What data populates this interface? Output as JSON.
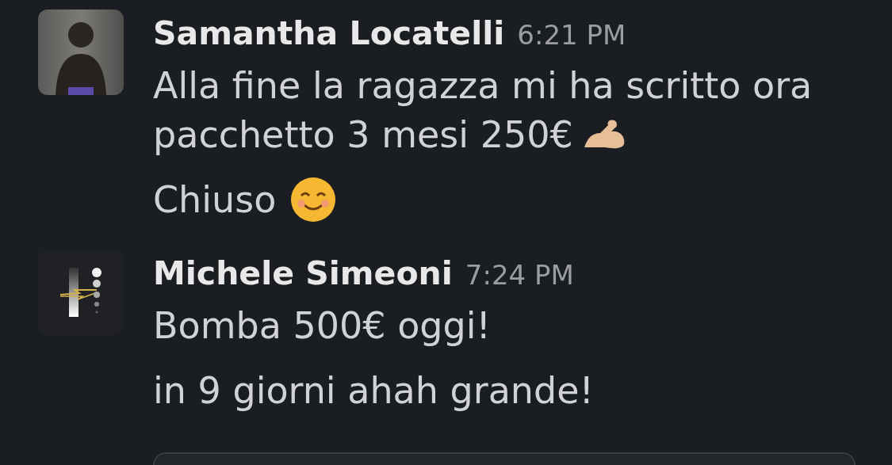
{
  "messages": [
    {
      "author": "Samantha Locatelli",
      "time": "6:21 PM",
      "avatar": {
        "kind": "photo"
      },
      "paragraphs": [
        {
          "kind": "arm-emoji",
          "lines": [
            "Alla fine la ragazza mi ha scritto ora",
            "pacchetto 3 mesi 250€"
          ]
        },
        {
          "kind": "smile-emoji",
          "lines": [
            "Chiuso"
          ]
        }
      ]
    },
    {
      "author": "Michele Simeoni",
      "time": "7:24 PM",
      "avatar": {
        "kind": "logo"
      },
      "paragraphs": [
        {
          "kind": "plain",
          "lines": [
            "Bomba 500€ oggi!"
          ]
        },
        {
          "kind": "plain",
          "lines": [
            "in 9 giorni ahah grande!"
          ]
        }
      ]
    }
  ]
}
